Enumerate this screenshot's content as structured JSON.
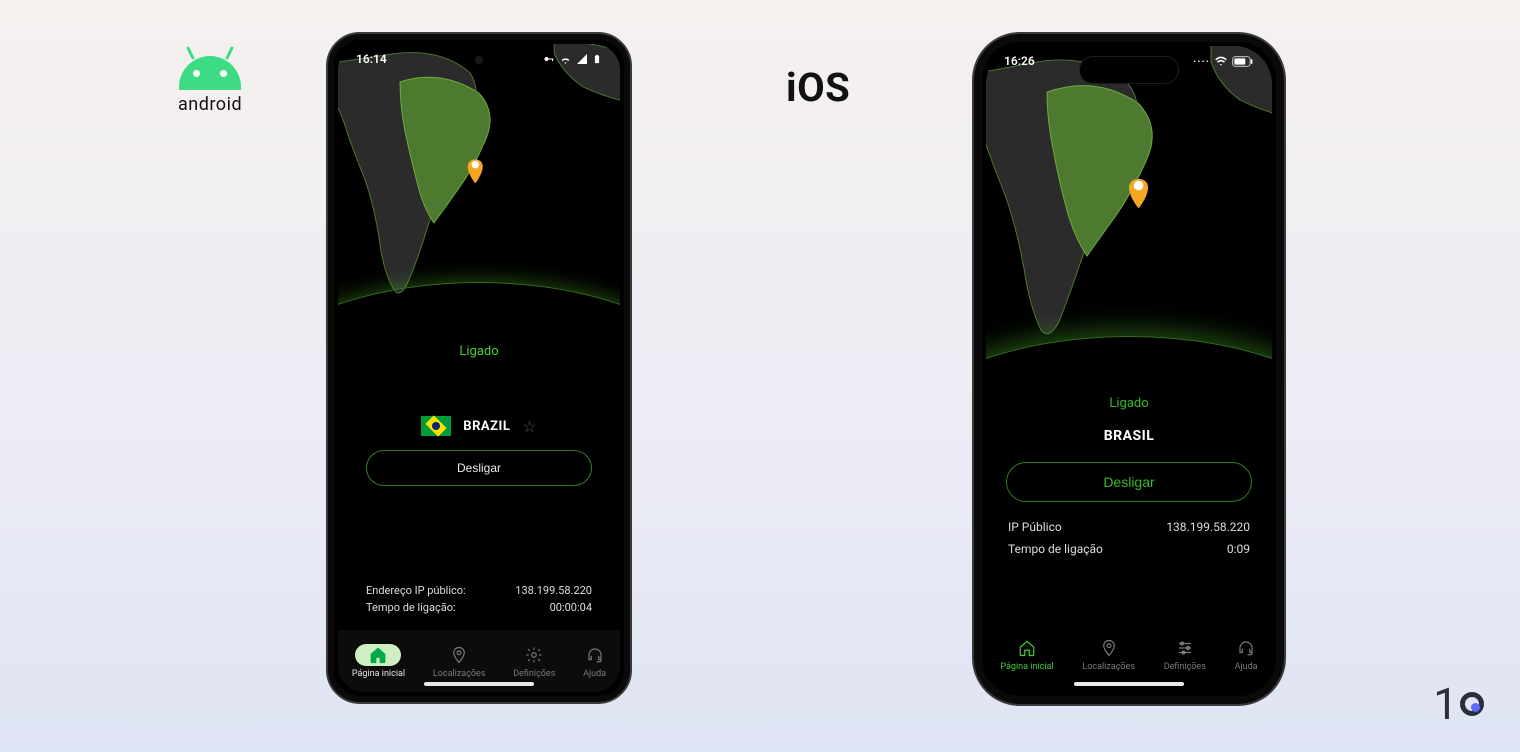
{
  "platform_labels": {
    "android": "android",
    "ios": "iOS"
  },
  "watermark": "10",
  "android": {
    "status_time": "16:14",
    "connection_state": "Ligado",
    "location_name": "BRAZIL",
    "disconnect_label": "Desligar",
    "ip_label": "Endereço IP público:",
    "ip_value": "138.199.58.220",
    "duration_label": "Tempo de ligação:",
    "duration_value": "00:00:04",
    "tabs": [
      {
        "id": "home",
        "label": "Página inicial",
        "active": true
      },
      {
        "id": "locations",
        "label": "Localizações",
        "active": false
      },
      {
        "id": "settings",
        "label": "Definições",
        "active": false
      },
      {
        "id": "help",
        "label": "Ajuda",
        "active": false
      }
    ]
  },
  "ios": {
    "status_time": "16:26",
    "connection_state": "Ligado",
    "location_name": "BRASIL",
    "disconnect_label": "Desligar",
    "ip_label": "IP Público",
    "ip_value": "138.199.58.220",
    "duration_label": "Tempo de ligação",
    "duration_value": "0:09",
    "tabs": [
      {
        "id": "home",
        "label": "Página inicial",
        "active": true
      },
      {
        "id": "locations",
        "label": "Localizações",
        "active": false
      },
      {
        "id": "settings",
        "label": "Definições",
        "active": false
      },
      {
        "id": "help",
        "label": "Ajuda",
        "active": false
      }
    ]
  }
}
